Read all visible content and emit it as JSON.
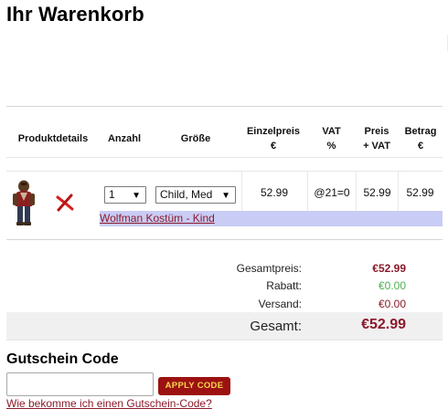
{
  "page": {
    "title": "Ihr Warenkorb"
  },
  "colors": {
    "accent": "#8b1a2b",
    "green": "#4caf50",
    "highlight_row": "#c9ccf5",
    "button_bg": "#9c1111",
    "button_text": "#f4d94c"
  },
  "table": {
    "headers": {
      "product": "Produktdetails",
      "qty": "Anzahl",
      "size": "Größe",
      "unit_price": [
        "Einzelpreis",
        "€"
      ],
      "vat": [
        "VAT",
        "%"
      ],
      "price_vat": [
        "Preis",
        "+ VAT"
      ],
      "amount": [
        "Betrag",
        "€"
      ]
    },
    "rows": [
      {
        "thumbnail_icon": "wolfman-costume-thumbnail",
        "remove_icon": "close-icon",
        "qty": "1",
        "size": "Child, Med",
        "unit_price": "52.99",
        "vat": "@21=0",
        "price_vat": "52.99",
        "amount": "52.99",
        "name": "Wolfman Kostüm - Kind"
      }
    ]
  },
  "totals": {
    "subtotal_label": "Gesamtpreis:",
    "subtotal_value": "€52.99",
    "discount_label": "Rabatt:",
    "discount_value": "€0.00",
    "shipping_label": "Versand:",
    "shipping_value": "€0.00",
    "grand_label": "Gesamt:",
    "grand_value": "€52.99"
  },
  "coupon": {
    "title": "Gutschein Code",
    "input_value": "",
    "input_placeholder": "",
    "apply_label": "APPLY CODE",
    "help_link": "Wie bekomme ich einen Gutschein-Code?"
  }
}
